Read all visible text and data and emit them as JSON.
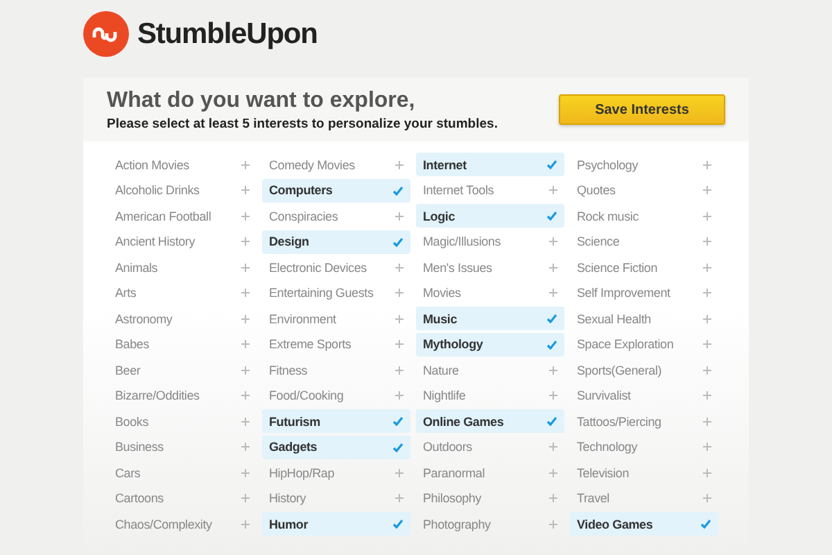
{
  "brand": {
    "name": "StumbleUpon"
  },
  "header": {
    "title": "What do you want to explore,",
    "subtitle": "Please select at least 5 interests to personalize your stumbles.",
    "button": "Save Interests"
  },
  "columns": [
    {
      "items": [
        {
          "label": "Action Movies",
          "selected": false
        },
        {
          "label": "Alcoholic Drinks",
          "selected": false
        },
        {
          "label": "American Football",
          "selected": false
        },
        {
          "label": "Ancient History",
          "selected": false
        },
        {
          "label": "Animals",
          "selected": false
        },
        {
          "label": "Arts",
          "selected": false
        },
        {
          "label": "Astronomy",
          "selected": false
        },
        {
          "label": "Babes",
          "selected": false
        },
        {
          "label": "Beer",
          "selected": false
        },
        {
          "label": "Bizarre/Oddities",
          "selected": false
        },
        {
          "label": "Books",
          "selected": false
        },
        {
          "label": "Business",
          "selected": false
        },
        {
          "label": "Cars",
          "selected": false
        },
        {
          "label": "Cartoons",
          "selected": false
        },
        {
          "label": "Chaos/Complexity",
          "selected": false
        }
      ]
    },
    {
      "items": [
        {
          "label": "Comedy Movies",
          "selected": false
        },
        {
          "label": "Computers",
          "selected": true
        },
        {
          "label": "Conspiracies",
          "selected": false
        },
        {
          "label": "Design",
          "selected": true
        },
        {
          "label": "Electronic Devices",
          "selected": false
        },
        {
          "label": "Entertaining Guests",
          "selected": false
        },
        {
          "label": "Environment",
          "selected": false
        },
        {
          "label": "Extreme Sports",
          "selected": false
        },
        {
          "label": "Fitness",
          "selected": false
        },
        {
          "label": "Food/Cooking",
          "selected": false
        },
        {
          "label": "Futurism",
          "selected": true
        },
        {
          "label": "Gadgets",
          "selected": true
        },
        {
          "label": "HipHop/Rap",
          "selected": false
        },
        {
          "label": "History",
          "selected": false
        },
        {
          "label": "Humor",
          "selected": true
        }
      ]
    },
    {
      "items": [
        {
          "label": "Internet",
          "selected": true
        },
        {
          "label": "Internet Tools",
          "selected": false
        },
        {
          "label": "Logic",
          "selected": true
        },
        {
          "label": "Magic/Illusions",
          "selected": false
        },
        {
          "label": "Men's Issues",
          "selected": false
        },
        {
          "label": "Movies",
          "selected": false
        },
        {
          "label": "Music",
          "selected": true
        },
        {
          "label": "Mythology",
          "selected": true
        },
        {
          "label": "Nature",
          "selected": false
        },
        {
          "label": "Nightlife",
          "selected": false
        },
        {
          "label": "Online Games",
          "selected": true
        },
        {
          "label": "Outdoors",
          "selected": false
        },
        {
          "label": "Paranormal",
          "selected": false
        },
        {
          "label": "Philosophy",
          "selected": false
        },
        {
          "label": "Photography",
          "selected": false
        }
      ]
    },
    {
      "items": [
        {
          "label": "Psychology",
          "selected": false
        },
        {
          "label": "Quotes",
          "selected": false
        },
        {
          "label": "Rock music",
          "selected": false
        },
        {
          "label": "Science",
          "selected": false
        },
        {
          "label": "Science Fiction",
          "selected": false
        },
        {
          "label": "Self Improvement",
          "selected": false
        },
        {
          "label": "Sexual Health",
          "selected": false
        },
        {
          "label": "Space Exploration",
          "selected": false
        },
        {
          "label": "Sports(General)",
          "selected": false
        },
        {
          "label": "Survivalist",
          "selected": false
        },
        {
          "label": "Tattoos/Piercing",
          "selected": false
        },
        {
          "label": "Technology",
          "selected": false
        },
        {
          "label": "Television",
          "selected": false
        },
        {
          "label": "Travel",
          "selected": false
        },
        {
          "label": "Video Games",
          "selected": true
        }
      ]
    }
  ]
}
